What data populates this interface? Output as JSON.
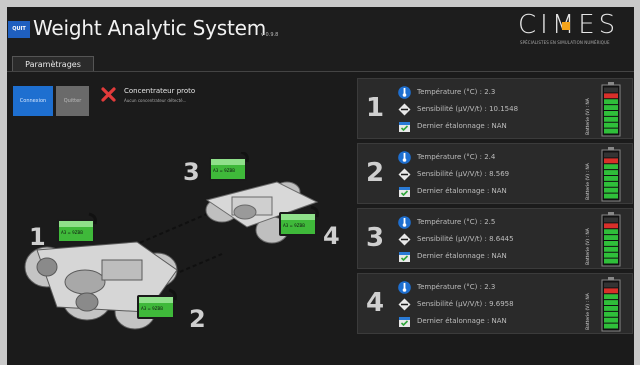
{
  "header": {
    "quit_label": "QUIT",
    "title": "Weight Analytic System",
    "version": "v 0.9.8",
    "logo_text": "CIMES",
    "logo_tagline": "SPÉCIALISTES EN SIMULATION NUMÉRIQUE"
  },
  "tabs": [
    {
      "label": "Paramètrages"
    }
  ],
  "toolbar": {
    "connect_label": "Connexion",
    "quit_label": "Quitter"
  },
  "status": {
    "title": "Concentrateur proto",
    "subtitle": "Aucun concentrateur détecté..."
  },
  "illustration": {
    "numbers": [
      "1",
      "2",
      "3",
      "4"
    ],
    "sticker_text": "A3 = 9ZBB"
  },
  "sensors": [
    {
      "number": "1",
      "temperature": "Température (°C) : 2.3",
      "sensitivity": "Sensibilité (µV/V/t) : 10.1548",
      "calibration": "Dernier étalonnage : NAN",
      "battery": "Batterie (V) : NA",
      "battery_level": 0.85
    },
    {
      "number": "2",
      "temperature": "Température (°C) : 2.4",
      "sensitivity": "Sensibilité (µV/V/t) : 8.569",
      "calibration": "Dernier étalonnage : NAN",
      "battery": "Batterie (V) : NA",
      "battery_level": 0.85
    },
    {
      "number": "3",
      "temperature": "Température (°C) : 2.5",
      "sensitivity": "Sensibilité (µV/V/t) : 8.6445",
      "calibration": "Dernier étalonnage : NAN",
      "battery": "Batterie (V) : NA",
      "battery_level": 0.85
    },
    {
      "number": "4",
      "temperature": "Température (°C) : 2.3",
      "sensitivity": "Sensibilité (µV/V/t) : 9.6958",
      "calibration": "Dernier étalonnage : NAN",
      "battery": "Batterie (V) : NA",
      "battery_level": 0.85
    }
  ],
  "icons": {
    "temperature": "thermometer-icon",
    "sensitivity": "sensor-diamond-icon",
    "calibration": "calendar-check-icon",
    "battery": "battery-gauge-icon",
    "status": "red-x-icon"
  },
  "colors": {
    "accent": "#1e6fd0",
    "logo_accent": "#f4a41c",
    "status_error": "#e23b3b",
    "battery_green": "#2fbf3a",
    "battery_red": "#d8302a"
  }
}
